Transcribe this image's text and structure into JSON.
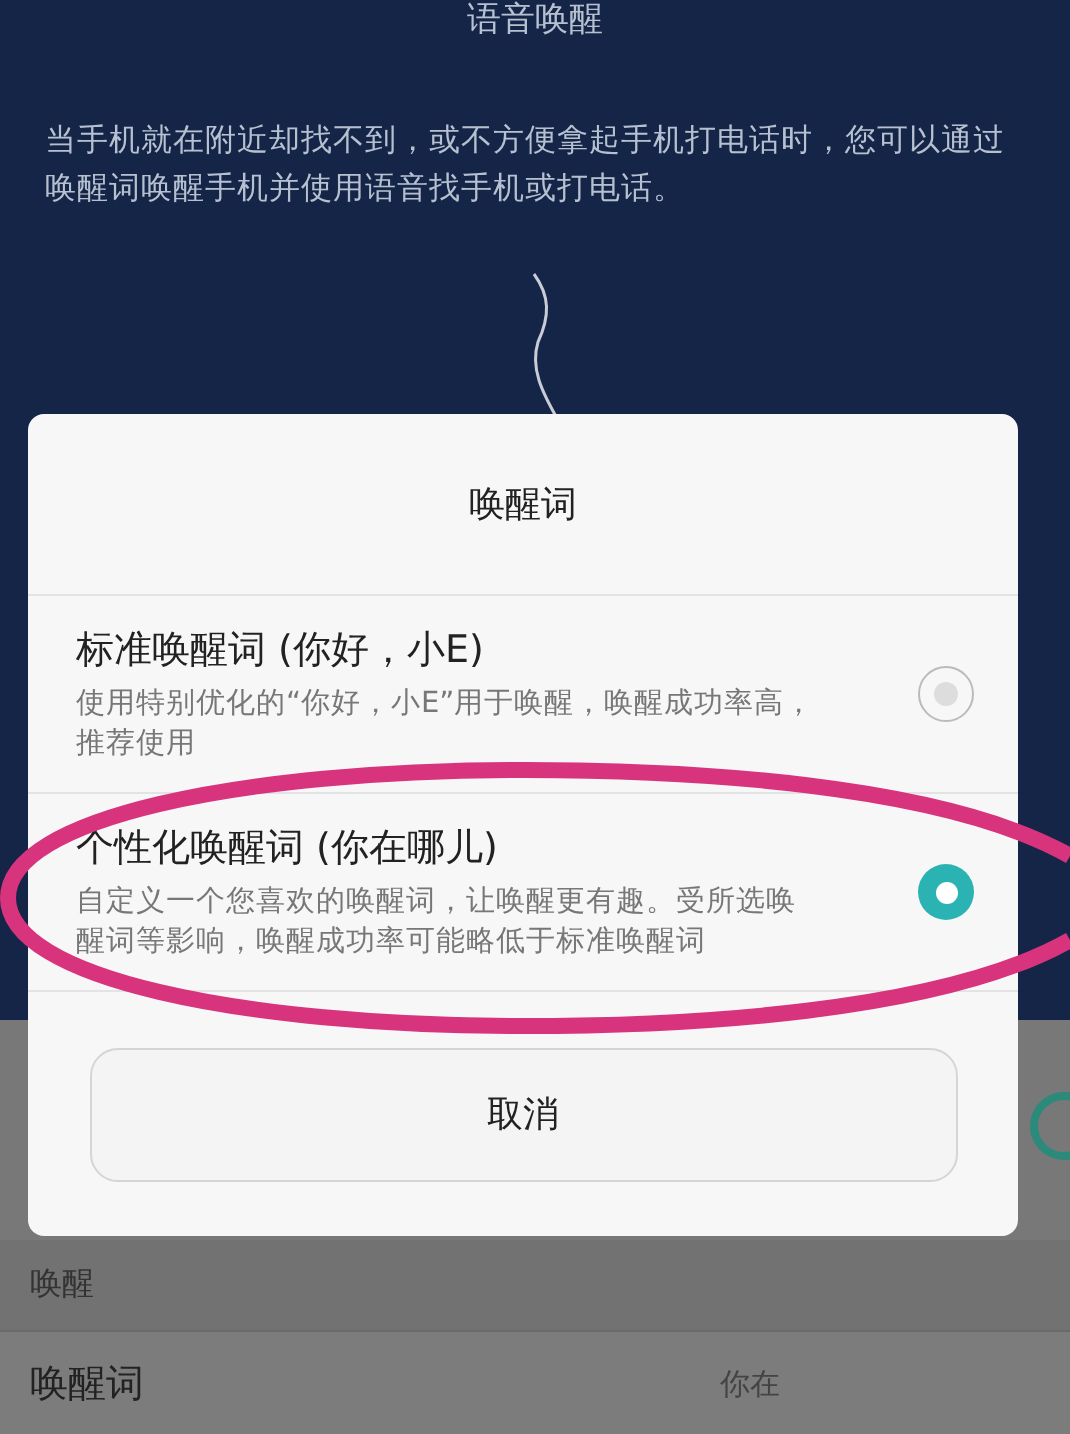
{
  "header": {
    "title": "语音唤醒",
    "description": "当手机就在附近却找不到，或不方便拿起手机打电话时，您可以通过唤醒词唤醒手机并使用语音找手机或打电话。"
  },
  "background": {
    "switch_on": true,
    "section_header": "唤醒",
    "rows": [
      {
        "label": "唤醒词",
        "value": "你在"
      }
    ]
  },
  "dialog": {
    "title": "唤醒词",
    "options": [
      {
        "label": "标准唤醒词 (你好，小E)",
        "description": "使用特别优化的“你好，小E”用于唤醒，唤醒成功率高，推荐使用",
        "selected": false
      },
      {
        "label": "个性化唤醒词 (你在哪儿)",
        "description": "自定义一个您喜欢的唤醒词，让唤醒更有趣。受所选唤醒词等影响，唤醒成功率可能略低于标准唤醒词",
        "selected": true
      }
    ],
    "cancel": "取消"
  }
}
